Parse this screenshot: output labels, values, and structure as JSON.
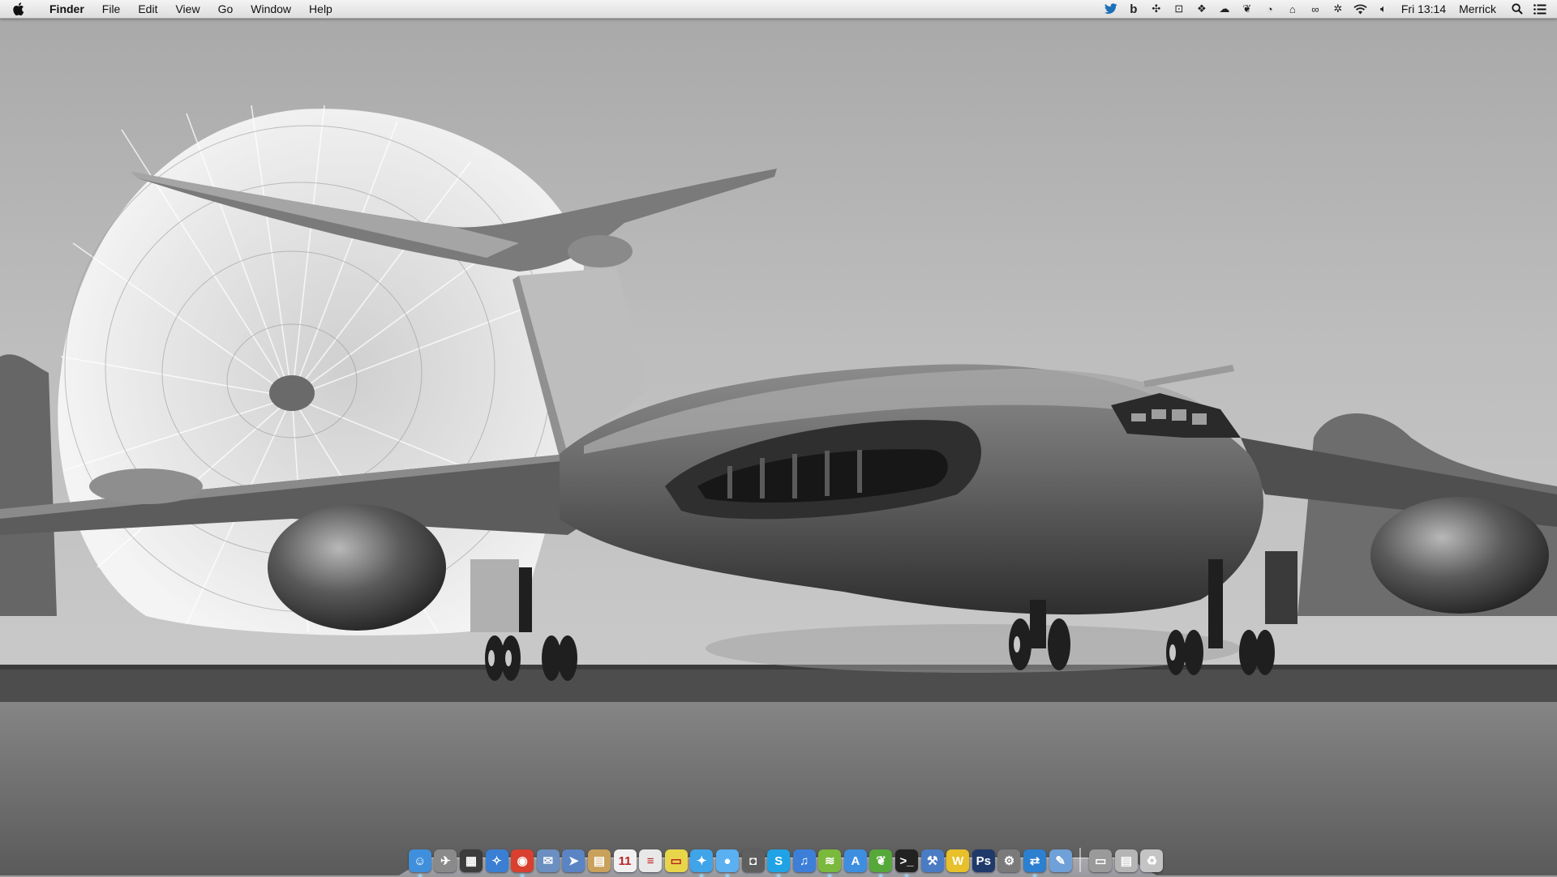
{
  "menubar": {
    "apple_icon": "apple-logo-icon",
    "app_name": "Finder",
    "menus": [
      "File",
      "Edit",
      "View",
      "Go",
      "Window",
      "Help"
    ],
    "status_icons": [
      "twitter-icon",
      "bitly-icon",
      "dropbox-sync-icon",
      "screen-capture-icon",
      "dropbox-icon",
      "cloud-icon",
      "evernote-icon",
      "time-machine-icon",
      "home-sync-icon",
      "binoculars-icon",
      "bluetooth-icon",
      "wifi-icon",
      "volume-icon"
    ],
    "clock": "Fri 13:14",
    "user": "Merrick",
    "search_icon": "spotlight-search-icon",
    "notification_icon": "notification-center-icon"
  },
  "desktop": {
    "wallpaper": "black-and-white photo of a jet tanker aircraft landing with a drag parachute",
    "colors": {
      "sky": "#b9b9b9",
      "runway": "#4a4a4a",
      "grass": "#6f6f6f"
    }
  },
  "dock": {
    "apps": [
      {
        "name": "finder",
        "icon": "finder-icon",
        "glyph": "☺",
        "color": "#3f8fdc",
        "running": true
      },
      {
        "name": "launchpad",
        "icon": "rocket-icon",
        "glyph": "✈",
        "color": "#8a8a8a",
        "running": false
      },
      {
        "name": "mission-control",
        "icon": "mission-control-icon",
        "glyph": "▦",
        "color": "#3c3c3c",
        "running": false
      },
      {
        "name": "safari",
        "icon": "compass-icon",
        "glyph": "✧",
        "color": "#3a7fd4",
        "running": false
      },
      {
        "name": "chrome",
        "icon": "chrome-icon",
        "glyph": "◉",
        "color": "#d9402f",
        "running": true
      },
      {
        "name": "mail",
        "icon": "stamp-icon",
        "glyph": "✉",
        "color": "#6a8fc0",
        "running": false
      },
      {
        "name": "sparrow",
        "icon": "paper-plane-icon",
        "glyph": "➤",
        "color": "#5b84c4",
        "running": false
      },
      {
        "name": "notes",
        "icon": "notebook-icon",
        "glyph": "▤",
        "color": "#c9a15a",
        "running": false
      },
      {
        "name": "calendar",
        "icon": "calendar-icon",
        "glyph": "11",
        "color": "#f1f1f1",
        "running": false
      },
      {
        "name": "textedit",
        "icon": "document-icon",
        "glyph": "≡",
        "color": "#e8e8e8",
        "running": false
      },
      {
        "name": "stickies",
        "icon": "sticky-note-icon",
        "glyph": "▭",
        "color": "#e8d64a",
        "running": false
      },
      {
        "name": "twitter",
        "icon": "twitter-bird-icon",
        "glyph": "✦",
        "color": "#3fa4e8",
        "running": true
      },
      {
        "name": "messages",
        "icon": "chat-bubble-icon",
        "glyph": "●",
        "color": "#5ab0f0",
        "running": true
      },
      {
        "name": "facetime",
        "icon": "camera-icon",
        "glyph": "◘",
        "color": "#5f5f5f",
        "running": false
      },
      {
        "name": "skype",
        "icon": "skype-icon",
        "glyph": "S",
        "color": "#1fa3e6",
        "running": true
      },
      {
        "name": "itunes",
        "icon": "music-note-icon",
        "glyph": "♫",
        "color": "#3d7fd8",
        "running": false
      },
      {
        "name": "spotify",
        "icon": "spotify-icon",
        "glyph": "≋",
        "color": "#7ab93c",
        "running": true
      },
      {
        "name": "app-store",
        "icon": "app-store-icon",
        "glyph": "A",
        "color": "#3d8ee0",
        "running": false
      },
      {
        "name": "evernote",
        "icon": "elephant-icon",
        "glyph": "❦",
        "color": "#56a83a",
        "running": true
      },
      {
        "name": "terminal",
        "icon": "terminal-icon",
        "glyph": ">_",
        "color": "#222",
        "running": true
      },
      {
        "name": "xcode",
        "icon": "hammer-icon",
        "glyph": "⚒",
        "color": "#4a7cc4",
        "running": false
      },
      {
        "name": "word",
        "icon": "word-icon",
        "glyph": "W",
        "color": "#e8c02a",
        "running": false
      },
      {
        "name": "photoshop",
        "icon": "photoshop-icon",
        "glyph": "Ps",
        "color": "#1f3a6a",
        "running": false
      },
      {
        "name": "system-preferences",
        "icon": "gear-icon",
        "glyph": "⚙",
        "color": "#7a7a7a",
        "running": false
      },
      {
        "name": "teamviewer",
        "icon": "teamviewer-icon",
        "glyph": "⇄",
        "color": "#2d7fd0",
        "running": true
      },
      {
        "name": "utilities",
        "icon": "pencil-cup-icon",
        "glyph": "✎",
        "color": "#6fa0d8",
        "running": false
      }
    ],
    "stacks": [
      {
        "name": "applications-folder",
        "icon": "folder-icon",
        "glyph": "▭",
        "color": "#9a9a9a"
      },
      {
        "name": "documents-stack",
        "icon": "documents-stack-icon",
        "glyph": "▤",
        "color": "#b5b5b5"
      },
      {
        "name": "trash",
        "icon": "trash-icon",
        "glyph": "♻",
        "color": "#c4c4c4"
      }
    ]
  }
}
